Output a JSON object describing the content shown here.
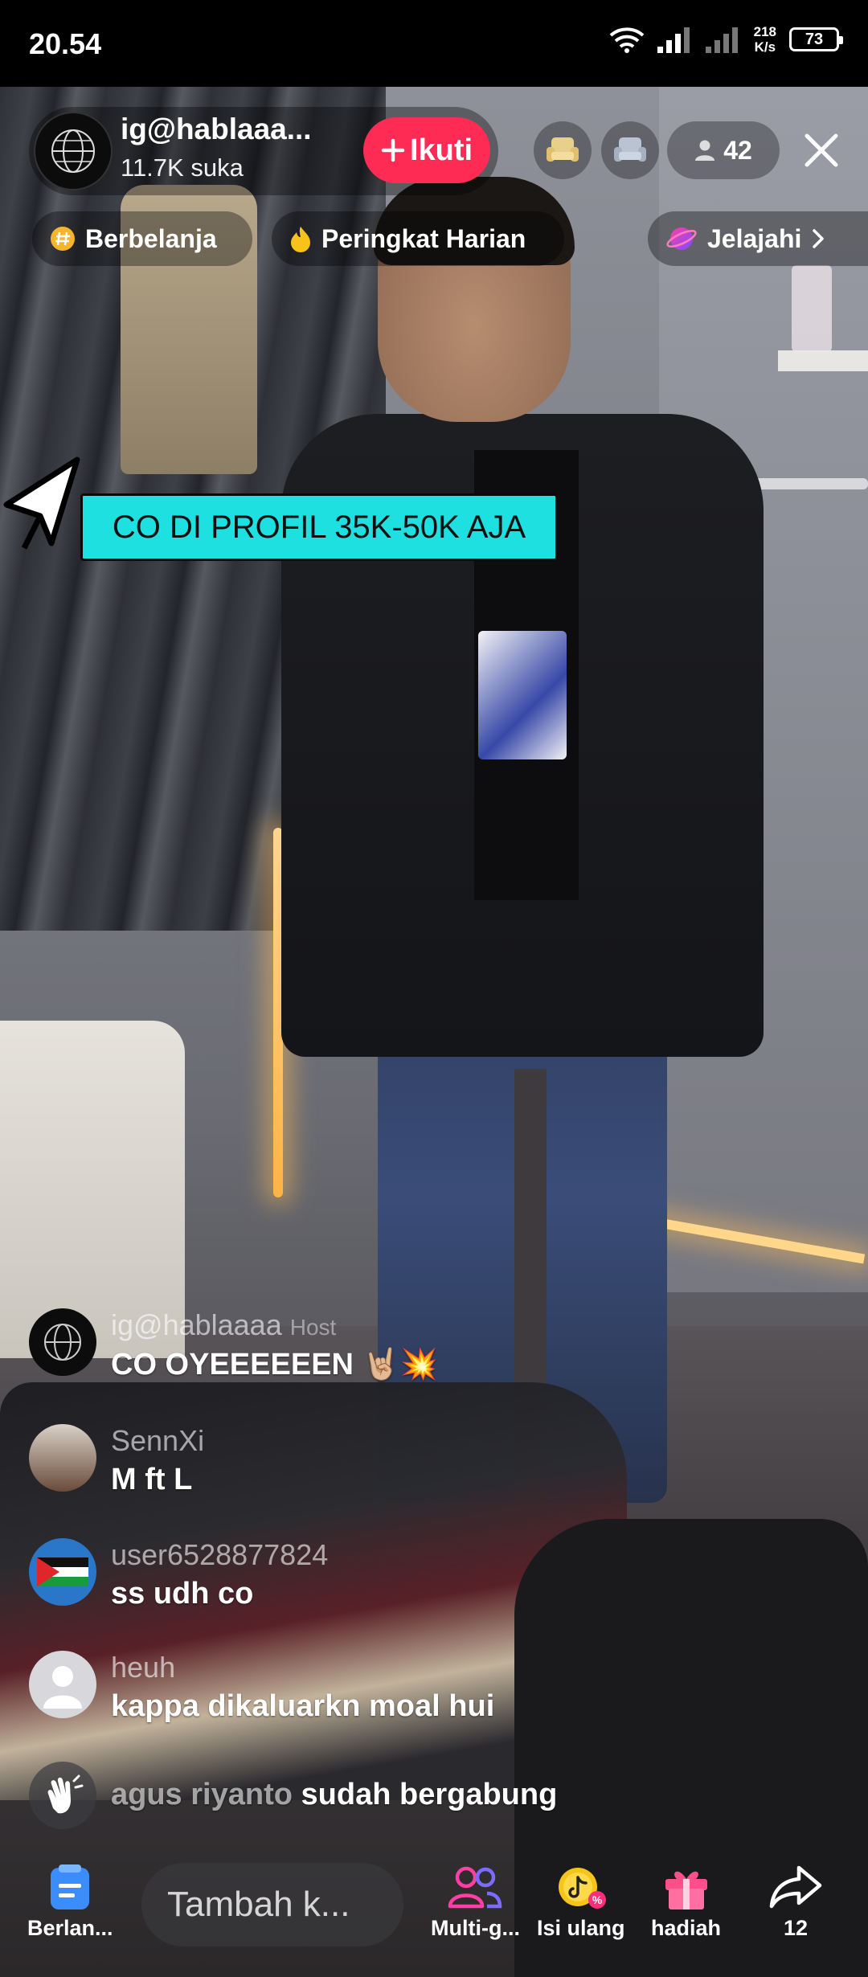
{
  "status_bar": {
    "time": "20.54",
    "net_speed_value": "218",
    "net_speed_unit": "K/s",
    "battery": "73"
  },
  "host": {
    "name": "ig@hablaaa...",
    "likes": "11.7K suka",
    "follow_label": "Ikuti",
    "viewers": "42"
  },
  "chips": {
    "shopping": "Berbelanja",
    "ranking": "Peringkat Harian",
    "explore": "Jelajahi"
  },
  "banner": {
    "text": "CO DI PROFIL 35K-50K AJA"
  },
  "comments": [
    {
      "user": "ig@hablaaaa",
      "tag": "Host",
      "text": "CO OYEEEEEEN 🤘🏼💥"
    },
    {
      "user": "SennXi",
      "text": "M ft L"
    },
    {
      "user": "user6528877824",
      "text": "ss udh co"
    },
    {
      "user": "heuh",
      "text": "kappa dikaluarkn moal hui"
    }
  ],
  "join_notice": {
    "user": "agus riyanto",
    "text": "sudah bergabung"
  },
  "bottom_bar": {
    "shop_label": "Berlan...",
    "comment_placeholder": "Tambah k...",
    "multi_guest_label": "Multi-g...",
    "recharge_label": "Isi ulang",
    "gift_label": "hadiah",
    "share_count": "12"
  },
  "colors": {
    "follow": "#fe2c55",
    "banner": "#1fe0e0"
  }
}
